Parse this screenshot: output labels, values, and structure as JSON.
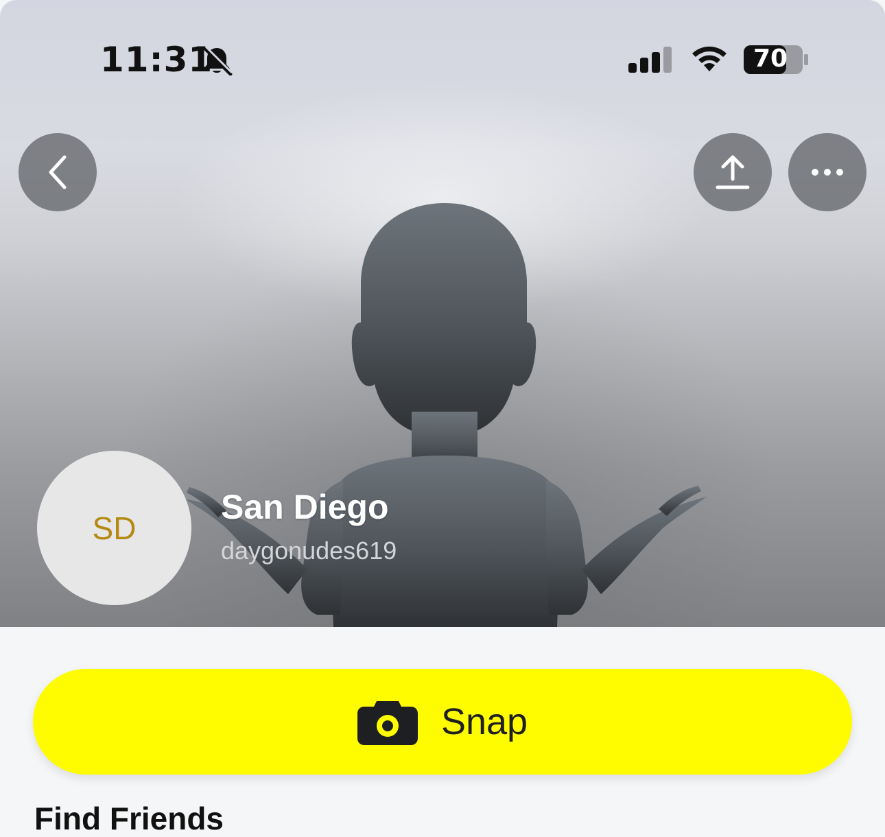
{
  "status_bar": {
    "time": "11:31",
    "battery": "70",
    "icons": [
      "bell-slash-icon",
      "signal-icon",
      "wifi-icon",
      "battery-icon"
    ]
  },
  "header": {
    "back_icon": "chevron-left-icon",
    "share_icon": "share-upload-icon",
    "more_icon": "ellipsis-icon"
  },
  "profile": {
    "initials": "SD",
    "display_name": "San Diego",
    "username": "daygonudes619",
    "initials_color": "#b58a12"
  },
  "actions": {
    "snap_label": "Snap",
    "snap_icon": "camera-icon",
    "accent": "#fffc00"
  },
  "sections": {
    "find_friends": "Find Friends"
  }
}
